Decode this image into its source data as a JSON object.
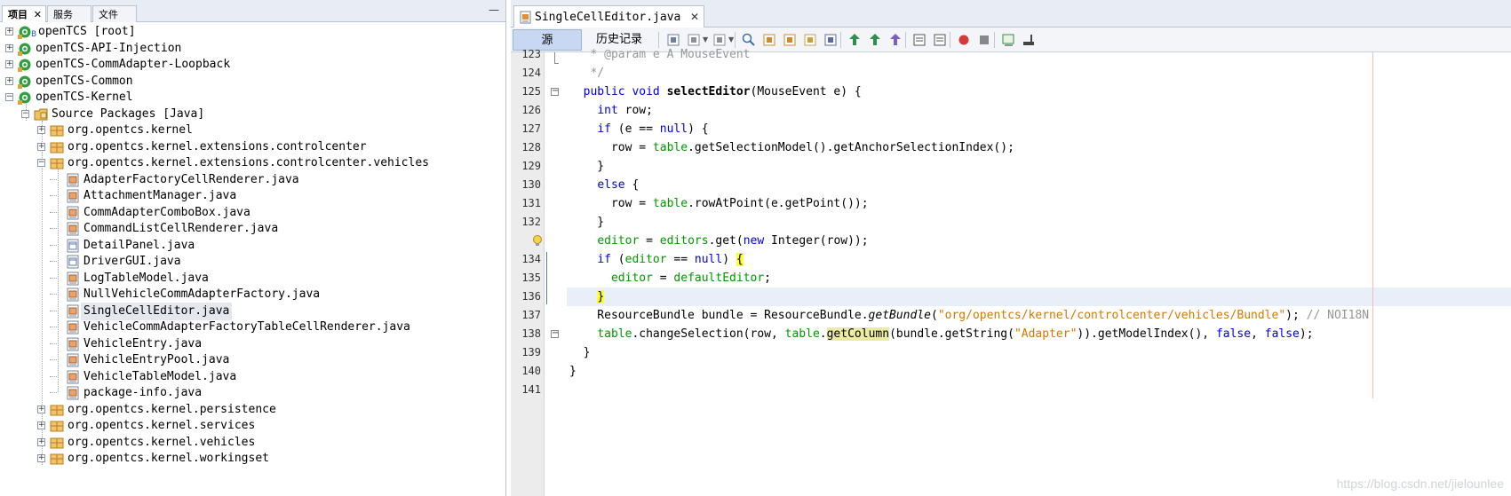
{
  "left_panel": {
    "tabs": [
      {
        "label": "项目",
        "close": "✕",
        "active": true
      },
      {
        "label": "服务",
        "active": false
      },
      {
        "label": "文件",
        "active": false
      }
    ],
    "minimize": "—",
    "tree": [
      {
        "label": "openTCS [root]",
        "icon": "project-icon",
        "toggle": "+",
        "level": 0,
        "superscript": "B"
      },
      {
        "label": "openTCS-API-Injection",
        "icon": "project-icon",
        "toggle": "+",
        "level": 0
      },
      {
        "label": "openTCS-CommAdapter-Loopback",
        "icon": "project-icon",
        "toggle": "+",
        "level": 0
      },
      {
        "label": "openTCS-Common",
        "icon": "project-icon",
        "toggle": "+",
        "level": 0
      },
      {
        "label": "openTCS-Kernel",
        "icon": "project-icon",
        "toggle": "−",
        "level": 0
      },
      {
        "label": "Source Packages [Java]",
        "icon": "source-folder-icon",
        "toggle": "−",
        "level": 1
      },
      {
        "label": "org.opentcs.kernel",
        "icon": "package-icon",
        "toggle": "+",
        "level": 2
      },
      {
        "label": "org.opentcs.kernel.extensions.controlcenter",
        "icon": "package-icon",
        "toggle": "+",
        "level": 2
      },
      {
        "label": "org.opentcs.kernel.extensions.controlcenter.vehicles",
        "icon": "package-icon",
        "toggle": "−",
        "level": 2
      },
      {
        "label": "AdapterFactoryCellRenderer.java",
        "icon": "java-file-icon",
        "level": 3
      },
      {
        "label": "AttachmentManager.java",
        "icon": "java-file-icon",
        "level": 3
      },
      {
        "label": "CommAdapterComboBox.java",
        "icon": "java-file-icon",
        "level": 3
      },
      {
        "label": "CommandListCellRenderer.java",
        "icon": "java-file-icon",
        "level": 3
      },
      {
        "label": "DetailPanel.java",
        "icon": "form-file-icon",
        "level": 3
      },
      {
        "label": "DriverGUI.java",
        "icon": "form-file-icon",
        "level": 3
      },
      {
        "label": "LogTableModel.java",
        "icon": "java-file-icon",
        "level": 3
      },
      {
        "label": "NullVehicleCommAdapterFactory.java",
        "icon": "java-file-icon",
        "level": 3
      },
      {
        "label": "SingleCellEditor.java",
        "icon": "java-file-icon",
        "level": 3,
        "selected": true
      },
      {
        "label": "VehicleCommAdapterFactoryTableCellRenderer.java",
        "icon": "java-file-icon",
        "level": 3
      },
      {
        "label": "VehicleEntry.java",
        "icon": "java-file-icon",
        "level": 3
      },
      {
        "label": "VehicleEntryPool.java",
        "icon": "java-file-icon",
        "level": 3
      },
      {
        "label": "VehicleTableModel.java",
        "icon": "java-file-icon",
        "level": 3
      },
      {
        "label": "package-info.java",
        "icon": "java-file-icon",
        "level": 3
      },
      {
        "label": "org.opentcs.kernel.persistence",
        "icon": "package-icon",
        "toggle": "+",
        "level": 2
      },
      {
        "label": "org.opentcs.kernel.services",
        "icon": "package-icon",
        "toggle": "+",
        "level": 2
      },
      {
        "label": "org.opentcs.kernel.vehicles",
        "icon": "package-icon",
        "toggle": "+",
        "level": 2
      },
      {
        "label": "org.opentcs.kernel.workingset",
        "icon": "package-icon",
        "toggle": "+",
        "level": 2
      }
    ]
  },
  "editor": {
    "file_tab": {
      "label": "SingleCellEditor.java",
      "close": "✕"
    },
    "view_tabs": {
      "source": "源",
      "history": "历史记录"
    },
    "toolbar_icons": [
      "last-edit-icon",
      "back-icon",
      "forward-icon",
      "find-icon",
      "find-previous-icon",
      "find-next-icon",
      "toggle-highlight-icon",
      "select-icon",
      "previous-bookmark-icon",
      "next-bookmark-icon",
      "toggle-bookmark-icon",
      "shift-left-icon",
      "shift-right-icon",
      "start-macro-icon",
      "stop-macro-icon",
      "comment-icon",
      "uncomment-icon"
    ],
    "line_numbers": [
      "123",
      "124",
      "125",
      "126",
      "127",
      "128",
      "129",
      "130",
      "131",
      "132",
      "133",
      "134",
      "135",
      "136",
      "137",
      "138",
      "139",
      "140",
      "141"
    ],
    "code_lines": [
      "   * @param e A MouseEvent",
      "   */",
      "  public void selectEditor(MouseEvent e) {",
      "    int row;",
      "    if (e == null) {",
      "      row = table.getSelectionModel().getAnchorSelectionIndex();",
      "    }",
      "    else {",
      "      row = table.rowAtPoint(e.getPoint());",
      "    }",
      "    editor = editors.get(new Integer(row));",
      "    if (editor == null) {",
      "      editor = defaultEditor;",
      "    }",
      "    ResourceBundle bundle = ResourceBundle.getBundle(\"org/opentcs/kernel/controlcenter/vehicles/Bundle\"); // NOI18N",
      "    table.changeSelection(row, table.getColumn(bundle.getString(\"Adapter\")).getModelIndex(), false, false);",
      "  }",
      "}",
      ""
    ],
    "highlighted_line": "136",
    "hint_line": "133"
  },
  "watermark": "https://blog.csdn.net/jielounlee",
  "colors": {
    "keyword": "#0000e6",
    "field": "#009900",
    "string": "#ce7b00",
    "comment": "#969696",
    "highlight": "#ffff33",
    "current_line": "#e9eff8"
  }
}
